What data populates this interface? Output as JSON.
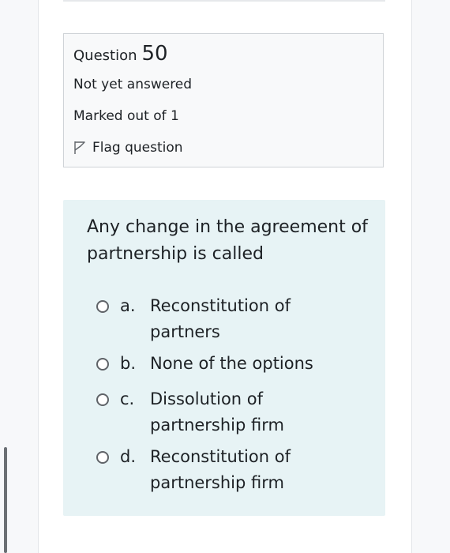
{
  "question": {
    "label": "Question",
    "number": "50",
    "state": "Not yet answered",
    "grade": "Marked out of 1",
    "flag_label": "Flag question",
    "flag_icon": "flag-icon"
  },
  "prompt": "Any change in the agreement of partnership is called",
  "options": [
    {
      "letter": "a.",
      "text": "Reconstitution of partners"
    },
    {
      "letter": "b.",
      "text": "None of the options"
    },
    {
      "letter": "c.",
      "text": "Dissolution of partnership firm"
    },
    {
      "letter": "d.",
      "text": "Reconstitution of partnership firm"
    }
  ],
  "colors": {
    "panel_background": "#e7f3f5",
    "info_background": "#f8f9fa",
    "info_border": "#cfd3d7"
  }
}
